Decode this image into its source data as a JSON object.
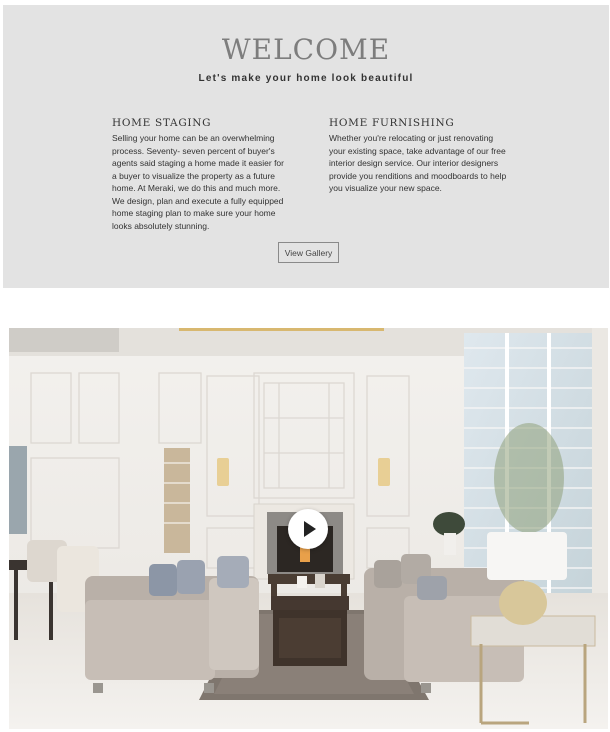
{
  "welcome": {
    "title": "WELCOME",
    "subtitle": "Let's make your home look beautiful",
    "staging": {
      "heading": "HOME STAGING",
      "body": "Selling your home can be an overwhelming process. Seventy- seven percent of buyer's agents said staging a home made it easier for a buyer to visualize the property as a future home. At Meraki, we do this and much more. We design, plan and execute a fully equipped home staging plan to make sure your home looks absolutely stunning."
    },
    "furnishing": {
      "heading": "HOME FURNISHING",
      "body": "Whether you're relocating or just renovating your existing space, take advantage of our free interior design service. Our interior designers provide you renditions and moodboards to help you visualize your new space."
    },
    "gallery_button": "View Gallery"
  },
  "video": {
    "play_icon": "play-icon"
  },
  "colors": {
    "panel_bg": "#e3e3e3",
    "title": "#7d7d7d",
    "text": "#333333"
  }
}
